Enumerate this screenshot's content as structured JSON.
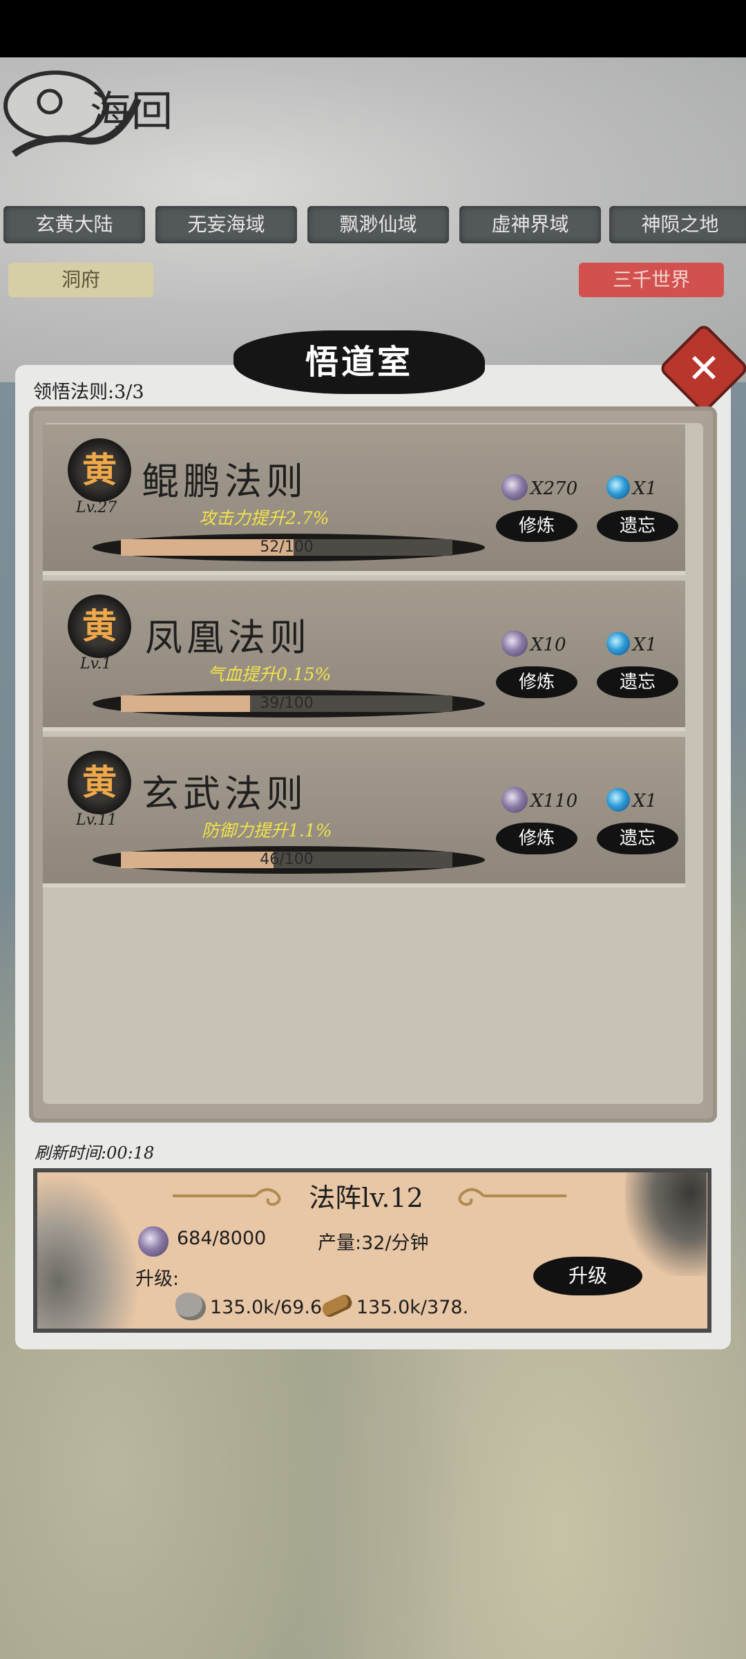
{
  "logo_text": "海回",
  "regions": [
    "玄黄大陆",
    "无妄海域",
    "飘渺仙域",
    "虚神界域",
    "神陨之地"
  ],
  "home_label": "洞府",
  "world_label": "三千世界",
  "dialog": {
    "title": "悟道室",
    "close_symbol": "✕",
    "comprehend_label": "领悟法则:3/3"
  },
  "laws": [
    {
      "grade": "黄",
      "level": "Lv.27",
      "name": "鲲鹏法则",
      "bonus": "攻击力提升2.7%",
      "progress_text": "52/100",
      "progress": 0.52,
      "stone_cost": "X270",
      "orb_cost": "X1",
      "train_label": "修炼",
      "forget_label": "遗忘"
    },
    {
      "grade": "黄",
      "level": "Lv.1",
      "name": "凤凰法则",
      "bonus": "气血提升0.15%",
      "progress_text": "39/100",
      "progress": 0.39,
      "stone_cost": "X10",
      "orb_cost": "X1",
      "train_label": "修炼",
      "forget_label": "遗忘"
    },
    {
      "grade": "黄",
      "level": "Lv.11",
      "name": "玄武法则",
      "bonus": "防御力提升1.1%",
      "progress_text": "46/100",
      "progress": 0.46,
      "stone_cost": "X110",
      "orb_cost": "X1",
      "train_label": "修炼",
      "forget_label": "遗忘"
    }
  ],
  "refresh_label": "刷新时间:00:18",
  "array": {
    "title": "法阵lv.12",
    "stone_amount": "684/8000",
    "output": "产量:32/分钟",
    "upgrade_label": "升级:",
    "rock_cost": "135.0k/69.6",
    "wood_cost": "135.0k/378.",
    "upgrade_button": "升级"
  }
}
